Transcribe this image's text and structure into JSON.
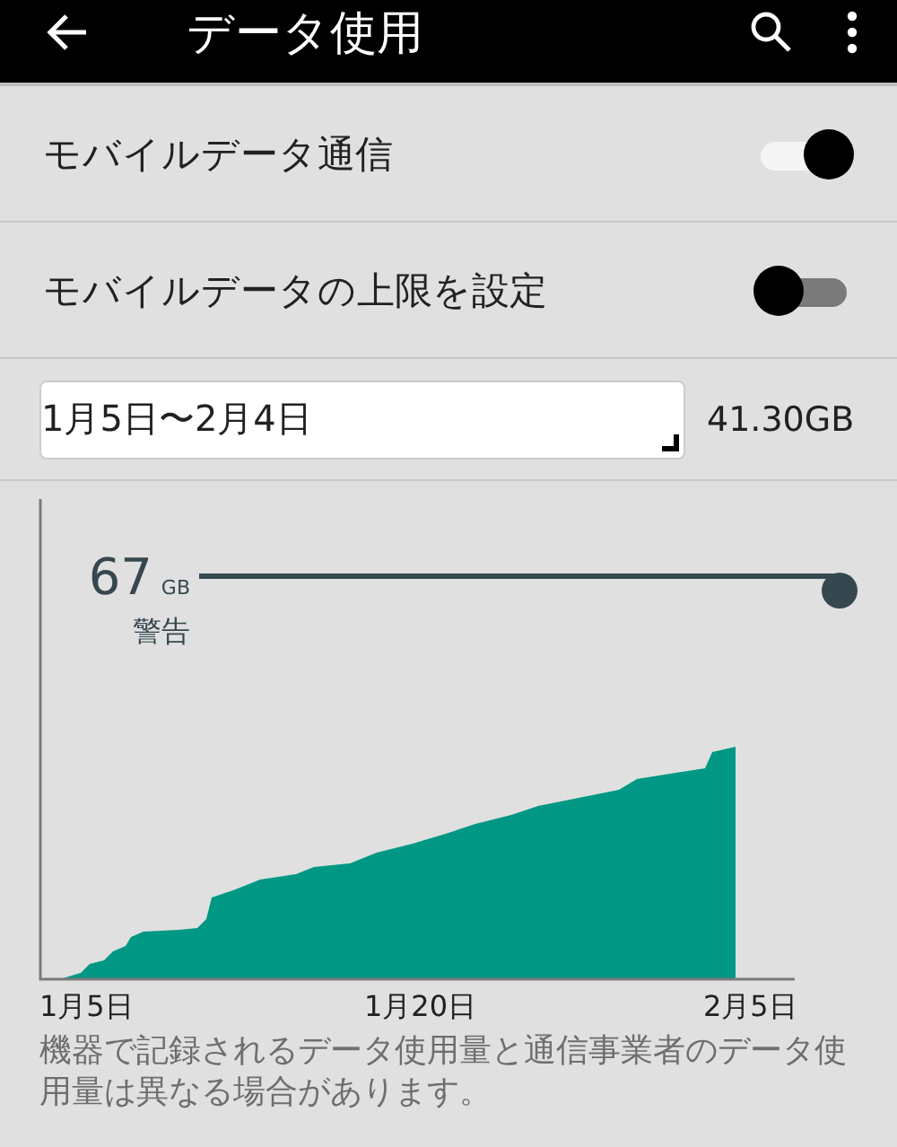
{
  "app_bar": {
    "title": "データ使用"
  },
  "settings": [
    {
      "label": "モバイルデータ通信",
      "on": true
    },
    {
      "label": "モバイルデータの上限を設定",
      "on": false
    }
  ],
  "cycle": {
    "value": "1月5日〜2月4日",
    "usage": "41.30GB"
  },
  "chart": {
    "warning_value": "67",
    "warning_unit": "GB",
    "warning_label": "警告",
    "x_labels": [
      "1月5日",
      "1月20日",
      "2月5日"
    ]
  },
  "note": "機器で記録されるデータ使用量と通信事業者のデータ使用量は異なる場合があります。"
}
